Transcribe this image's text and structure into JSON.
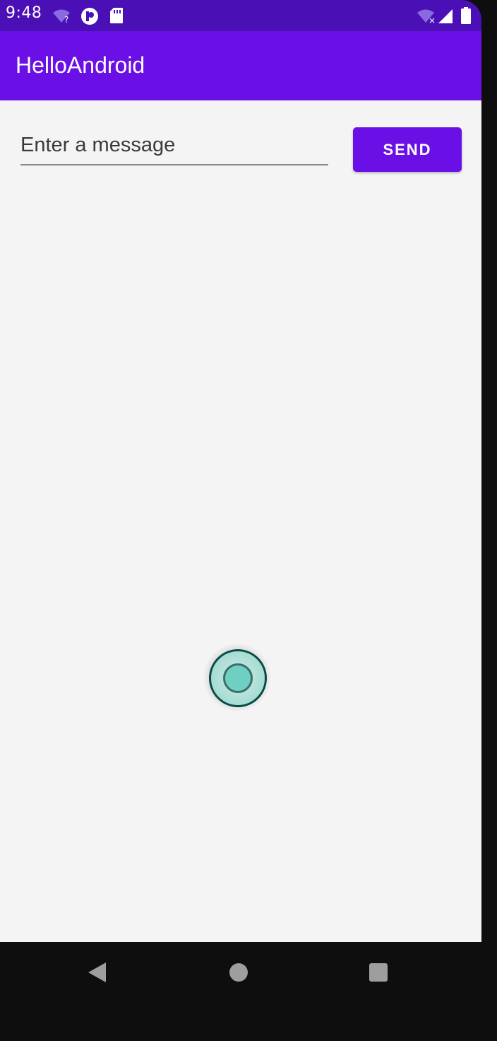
{
  "status_bar": {
    "time": "9:48",
    "icons": [
      "wifi-question-icon",
      "vpn-icon",
      "sd-card-icon",
      "wifi-x-icon",
      "signal-icon",
      "battery-icon"
    ]
  },
  "app_bar": {
    "title": "HelloAndroid"
  },
  "form": {
    "message_placeholder": "Enter a message",
    "message_value": "",
    "send_label": "SEND"
  },
  "nav_bar": {
    "icons": [
      "back-icon",
      "home-icon",
      "recents-icon"
    ]
  },
  "colors": {
    "status_bar": "#4a0fb5",
    "primary": "#6a10e6",
    "background": "#f4f4f5",
    "nav_bar": "#0e0e0e"
  }
}
